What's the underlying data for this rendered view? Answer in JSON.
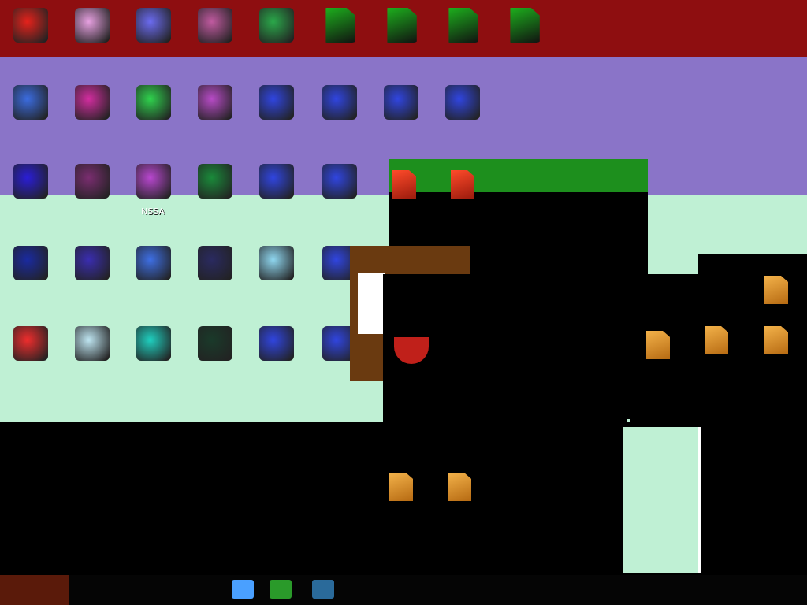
{
  "desktop": {
    "row1": [
      {
        "name": "app-icon-1",
        "label": "",
        "color": "#e5221b"
      },
      {
        "name": "app-icon-2",
        "label": "",
        "color": "#e6a0e0"
      },
      {
        "name": "app-icon-3",
        "label": "",
        "color": "#6b6bf0"
      },
      {
        "name": "app-icon-4",
        "label": "",
        "color": "#c05aa0"
      },
      {
        "name": "app-icon-5",
        "label": "",
        "color": "#2aa84a"
      },
      {
        "name": "file-icon-1",
        "label": "",
        "color": "#1db31d"
      },
      {
        "name": "file-icon-2",
        "label": "",
        "color": "#1db31d"
      },
      {
        "name": "file-icon-3",
        "label": "",
        "color": "#1db31d"
      },
      {
        "name": "file-icon-4",
        "label": "",
        "color": "#1db31d"
      }
    ],
    "row2": [
      {
        "name": "app-icon-6",
        "label": "",
        "color": "#3b6ce0"
      },
      {
        "name": "app-icon-7",
        "label": "",
        "color": "#d22d9f"
      },
      {
        "name": "app-icon-8",
        "label": "",
        "color": "#2fd24d"
      },
      {
        "name": "app-icon-9",
        "label": "",
        "color": "#b74bc6"
      },
      {
        "name": "app-icon-10",
        "label": "",
        "color": "#3045e0"
      },
      {
        "name": "app-icon-11",
        "label": "",
        "color": "#3045e0"
      },
      {
        "name": "app-icon-12",
        "label": "",
        "color": "#3045e0"
      },
      {
        "name": "app-icon-13",
        "label": "",
        "color": "#3045e0"
      }
    ],
    "row3": [
      {
        "name": "app-icon-14",
        "label": "",
        "color": "#2a1dd6"
      },
      {
        "name": "app-icon-15",
        "label": "",
        "color": "#7a2d70"
      },
      {
        "name": "app-icon-16",
        "label": "NSSA",
        "color": "#b847cf"
      },
      {
        "name": "app-icon-17",
        "label": "",
        "color": "#1a8a3a"
      },
      {
        "name": "app-icon-18",
        "label": "",
        "color": "#3045e0"
      },
      {
        "name": "app-icon-19",
        "label": "",
        "color": "#3045e0"
      }
    ],
    "row4": [
      {
        "name": "app-icon-20",
        "label": "",
        "color": "#1a2aa0"
      },
      {
        "name": "app-icon-21",
        "label": "",
        "color": "#3a2db0"
      },
      {
        "name": "app-icon-22",
        "label": "",
        "color": "#3e6fe4"
      },
      {
        "name": "app-icon-23",
        "label": "",
        "color": "#2a2a60"
      },
      {
        "name": "app-icon-24",
        "label": "",
        "color": "#8fd7f0"
      },
      {
        "name": "app-icon-25",
        "label": "",
        "color": "#3045e0"
      }
    ],
    "row5": [
      {
        "name": "app-icon-26",
        "label": "",
        "color": "#ef2d2d"
      },
      {
        "name": "app-icon-27",
        "label": "",
        "color": "#bfe6f2"
      },
      {
        "name": "app-icon-28",
        "label": "",
        "color": "#1fd0c0"
      },
      {
        "name": "app-icon-29",
        "label": "",
        "color": "#1a3a2a"
      },
      {
        "name": "app-icon-30",
        "label": "",
        "color": "#3045e0"
      },
      {
        "name": "app-icon-31",
        "label": "",
        "color": "#3045e0"
      }
    ],
    "row6": [
      {
        "name": "app-icon-32",
        "label": "",
        "color": "#ffffff"
      },
      {
        "name": "app-icon-33",
        "label": "",
        "color": "#e5221b"
      },
      {
        "name": "app-icon-34",
        "label": "",
        "color": "#2a7ee6"
      },
      {
        "name": "app-icon-35",
        "label": "",
        "color": "#c24a30"
      },
      {
        "name": "file-icon-5",
        "label": "",
        "color": "#e5541b"
      },
      {
        "name": "file-icon-6",
        "label": "",
        "color": "#e5541b"
      },
      {
        "name": "file-icon-7",
        "label": "",
        "color": "#e89b2c"
      },
      {
        "name": "file-icon-8",
        "label": "",
        "color": "#e89b2c"
      }
    ],
    "overlay_files_bottom": [
      {
        "name": "overlay-file-1",
        "label": ""
      },
      {
        "name": "overlay-file-2",
        "label": ""
      }
    ],
    "overlay_files_right": [
      {
        "name": "overlay-file-3",
        "label": ""
      },
      {
        "name": "overlay-file-4",
        "label": ""
      },
      {
        "name": "overlay-file-5",
        "label": ""
      },
      {
        "name": "overlay-file-6",
        "label": ""
      }
    ]
  },
  "taskbar": {
    "items": [
      {
        "name": "chrome-taskbar-icon",
        "color": "#4aa0ff"
      },
      {
        "name": "folder-taskbar-icon",
        "color": "#2a9a2a"
      },
      {
        "name": "app-taskbar-icon",
        "color": "#2a6a9a"
      }
    ]
  }
}
